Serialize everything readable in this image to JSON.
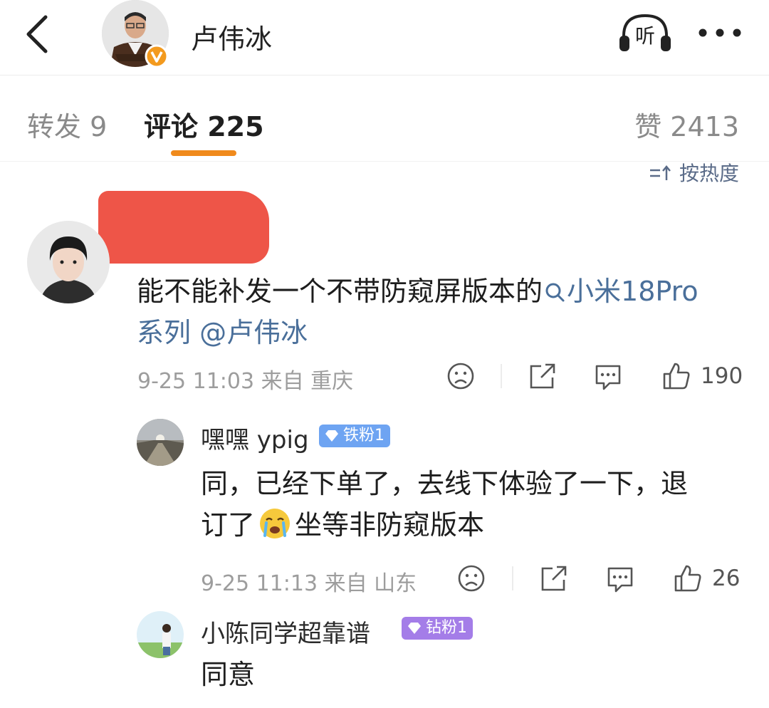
{
  "header": {
    "back_icon": "chevron-left-icon",
    "author_name": "卢伟冰",
    "listen_label": "听",
    "more_icon": "more-horizontal-icon"
  },
  "tabs": {
    "forward": "转发 9",
    "comments": "评论 225",
    "likes": "赞 2413",
    "active_color": "#f08a1c"
  },
  "sort_label": "按热度",
  "comment": {
    "text_plain": "能不能补发一个不带防窥屏版本的",
    "topic_text": "小米18Pro系列",
    "mention_text": "@卢伟冰",
    "meta": "9-25 11:03 来自 重庆",
    "like_count": "190"
  },
  "replies": [
    {
      "name": "嘿嘿 ypig",
      "badge": "铁粉1",
      "badge_color": "#6ea4f2",
      "text_line1": "同，已经下单了，去线下体验了一下，退",
      "text_line2_a": "订了",
      "emoji_icon": "crying-face-icon",
      "text_line2_b": "坐等非防窥版本",
      "meta": "9-25 11:13 来自 山东",
      "like_count": "26"
    },
    {
      "name": "小陈同学超靠谱",
      "badge": "钻粉1",
      "badge_color": "#a47de8",
      "text": "同意"
    }
  ],
  "colors": {
    "link": "#4a6f9a",
    "meta_gray": "#9d9d9d",
    "redaction": "#ee5548"
  }
}
